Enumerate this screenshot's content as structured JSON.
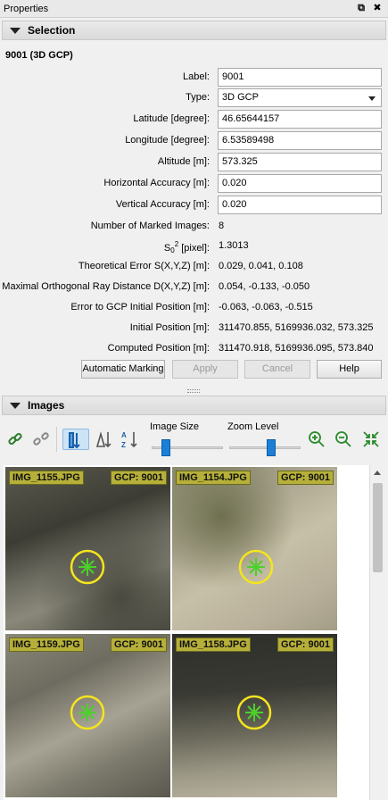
{
  "window": {
    "title": "Properties",
    "float_icon": "⧉",
    "close_icon": "✖"
  },
  "selection": {
    "header": "Selection",
    "title": "9001 (3D GCP)",
    "fields": {
      "label": {
        "label": "Label:",
        "value": "9001"
      },
      "type": {
        "label": "Type:",
        "value": "3D GCP"
      },
      "latitude": {
        "label": "Latitude [degree]:",
        "value": "46.65644157"
      },
      "longitude": {
        "label": "Longitude [degree]:",
        "value": "6.53589498"
      },
      "altitude": {
        "label": "Altitude [m]:",
        "value": "573.325"
      },
      "h_accuracy": {
        "label": "Horizontal Accuracy [m]:",
        "value": "0.020"
      },
      "v_accuracy": {
        "label": "Vertical Accuracy [m]:",
        "value": "0.020"
      },
      "marked_images": {
        "label": "Number of Marked Images:",
        "value": "8"
      },
      "s0": {
        "label_main": "S",
        "label_sub": "0",
        "label_sup": "2",
        "label_rest": " [pixel]:",
        "value": "1.3013"
      },
      "theoretical_error": {
        "label": "Theoretical Error S(X,Y,Z) [m]:",
        "value": "0.029, 0.041, 0.108"
      },
      "max_ray_distance": {
        "label": "Maximal Orthogonal Ray Distance D(X,Y,Z) [m]:",
        "value": "0.054, -0.133, -0.050"
      },
      "error_initial": {
        "label": "Error to GCP Initial Position [m]:",
        "value": "-0.063, -0.063, -0.515"
      },
      "initial_position": {
        "label": "Initial Position [m]:",
        "value": "311470.855, 5169936.032, 573.325"
      },
      "computed_position": {
        "label": "Computed Position [m]:",
        "value": "311470.918, 5169936.095, 573.840"
      }
    },
    "buttons": {
      "automatic_marking": "Automatic Marking",
      "apply": "Apply",
      "cancel": "Cancel",
      "help": "Help"
    }
  },
  "images": {
    "header": "Images",
    "toolbar": {
      "image_size_label": "Image Size",
      "zoom_level_label": "Zoom Level",
      "image_size_fraction": 0.15,
      "zoom_level_fraction": 0.6,
      "icons": [
        "link-icon",
        "unlink-icon",
        "sort-column-icon",
        "sort-descending-icon",
        "sort-alpha-icon",
        "zoom-in-icon",
        "zoom-out-icon",
        "fit-icon"
      ]
    },
    "thumbnails": [
      {
        "name": "IMG_1155.JPG",
        "gcp": "GCP: 9001",
        "selected": false
      },
      {
        "name": "IMG_1154.JPG",
        "gcp": "GCP: 9001",
        "selected": true
      },
      {
        "name": "IMG_1159.JPG",
        "gcp": "GCP: 9001",
        "selected": false
      },
      {
        "name": "IMG_1158.JPG",
        "gcp": "GCP: 9001",
        "selected": false
      }
    ]
  },
  "colors": {
    "accent_blue": "#1a7fd6",
    "selection_orange": "#f08a1c",
    "label_olive": "#b6b03a",
    "marker_yellow": "#f5e51c",
    "marker_green": "#4bd12a"
  }
}
